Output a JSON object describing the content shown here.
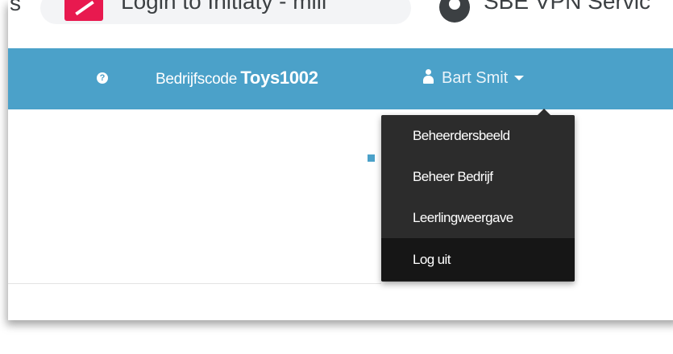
{
  "browser": {
    "bookmarks": [
      {
        "label": "Login to Initiaty - mill",
        "icon": "bookmark-favicon-icon",
        "color": "#e8194f"
      },
      {
        "label": "SBE VPN Servic",
        "icon": "vpn-favicon-icon"
      }
    ],
    "left_fragment": "s"
  },
  "navbar": {
    "background": "#4ba1c9",
    "help_icon": "question-circle-icon",
    "company_code_label": "Bedrijfscode",
    "company_code_value": "Toys1002",
    "user_icon": "user-icon",
    "user_name": "Bart Smit",
    "caret_icon": "chevron-down-icon"
  },
  "user_menu": {
    "items": [
      {
        "label": "Beheerdersbeeld"
      },
      {
        "label": "Beheer Bedrijf"
      },
      {
        "label": "Leerlingweergave"
      },
      {
        "label": "Log uit",
        "active": true
      }
    ]
  }
}
